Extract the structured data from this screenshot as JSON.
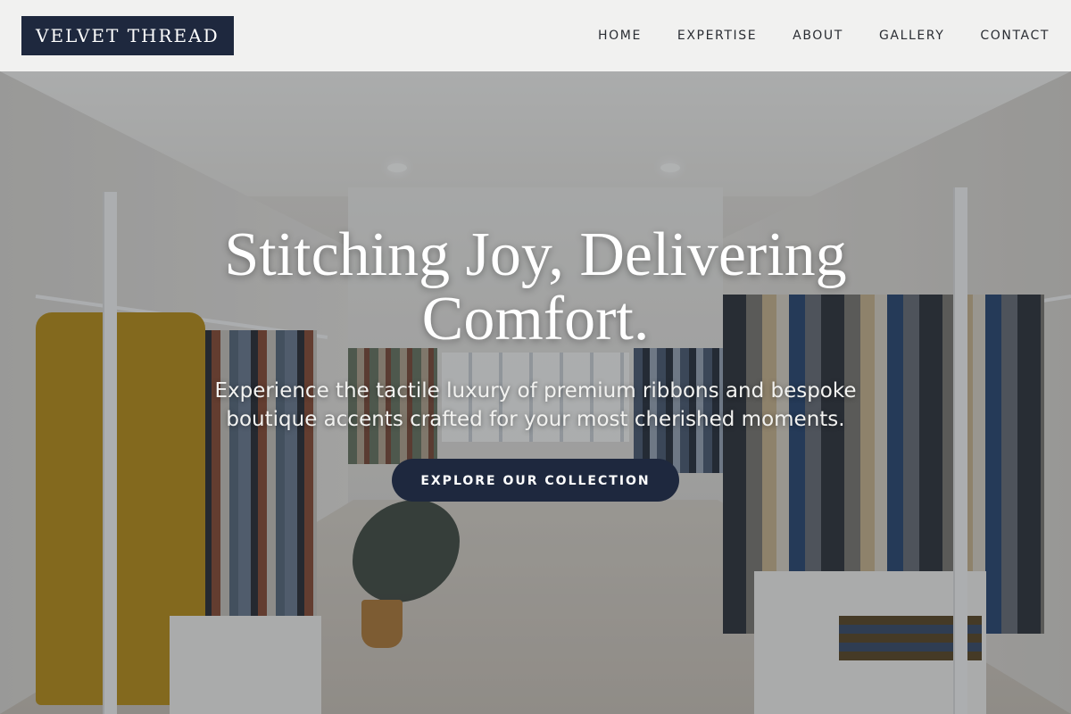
{
  "brand": {
    "logo_text": "VELVET THREAD"
  },
  "nav": {
    "items": [
      "HOME",
      "EXPERTISE",
      "ABOUT",
      "GALLERY",
      "CONTACT"
    ]
  },
  "hero": {
    "title": "Stitching Joy, Delivering Comfort.",
    "subtitle": "Experience the tactile luxury of premium ribbons and bespoke boutique accents crafted for your most cherished moments.",
    "cta_label": "EXPLORE OUR COLLECTION",
    "background_image": "boutique clothing store interior with garment racks"
  },
  "colors": {
    "brand_navy": "#1e283e",
    "header_bg": "#f5f5f4",
    "nav_text": "#2a2d33",
    "hero_text": "#ffffff"
  }
}
